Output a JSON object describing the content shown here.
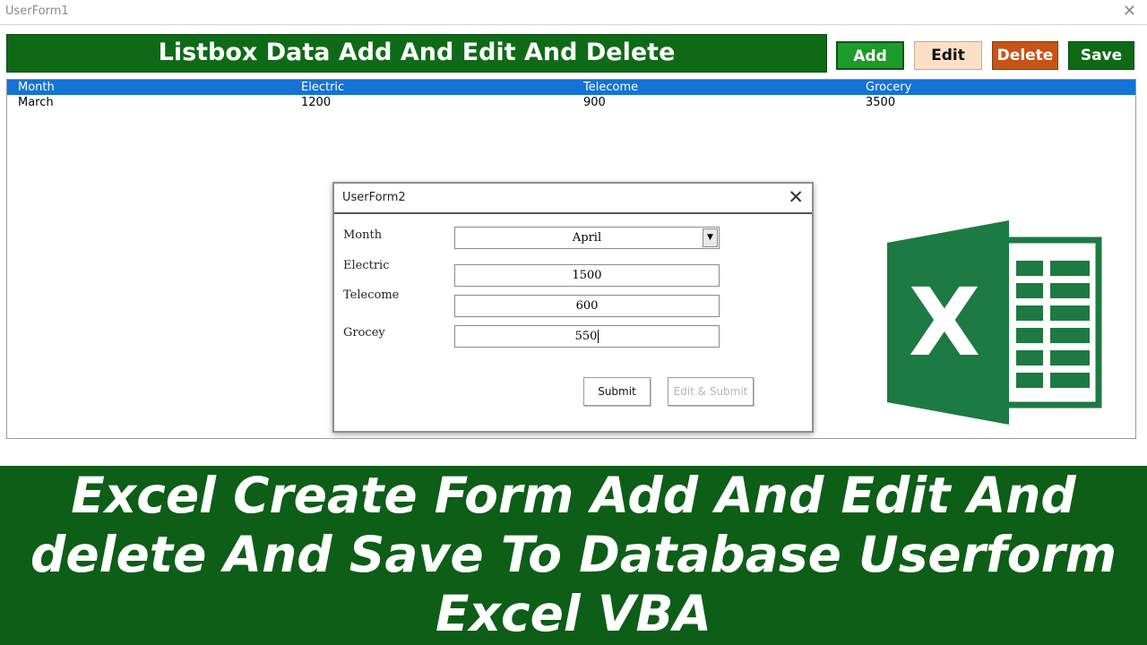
{
  "window": {
    "title": "UserForm1",
    "close": "✕"
  },
  "header": {
    "title": "Listbox Data Add And Edit And Delete"
  },
  "toolbar": {
    "add_label": "Add",
    "edit_label": "Edit",
    "delete_label": "Delete",
    "save_label": "Save"
  },
  "listbox": {
    "columns": [
      "Month",
      "Electric",
      "Telecome",
      "Grocery"
    ],
    "rows": [
      [
        "March",
        "1200",
        "900",
        "3500"
      ]
    ]
  },
  "dialog": {
    "title": "UserForm2",
    "close": "✕",
    "labels": {
      "month": "Month",
      "electric": "Electric",
      "telecome": "Telecome",
      "grocey": "Grocey"
    },
    "values": {
      "month": "April",
      "electric": "1500",
      "telecome": "600",
      "grocey": "550"
    },
    "submit_label": "Submit",
    "edit_submit_label": "Edit & Submit"
  },
  "logo": {
    "letter": "X",
    "icon": "excel-logo-icon"
  },
  "caption": {
    "line1": "Excel Create Form Add And Edit And",
    "line2": "delete And Save To Database Userform",
    "line3": "Excel VBA"
  },
  "colors": {
    "brand_green": "#0f6a17",
    "add_green": "#1e9a2a",
    "edit_peach": "#fbdfc6",
    "delete_orange": "#c65416",
    "list_header_blue": "#1473d4",
    "excel_green": "#1d7a42"
  }
}
